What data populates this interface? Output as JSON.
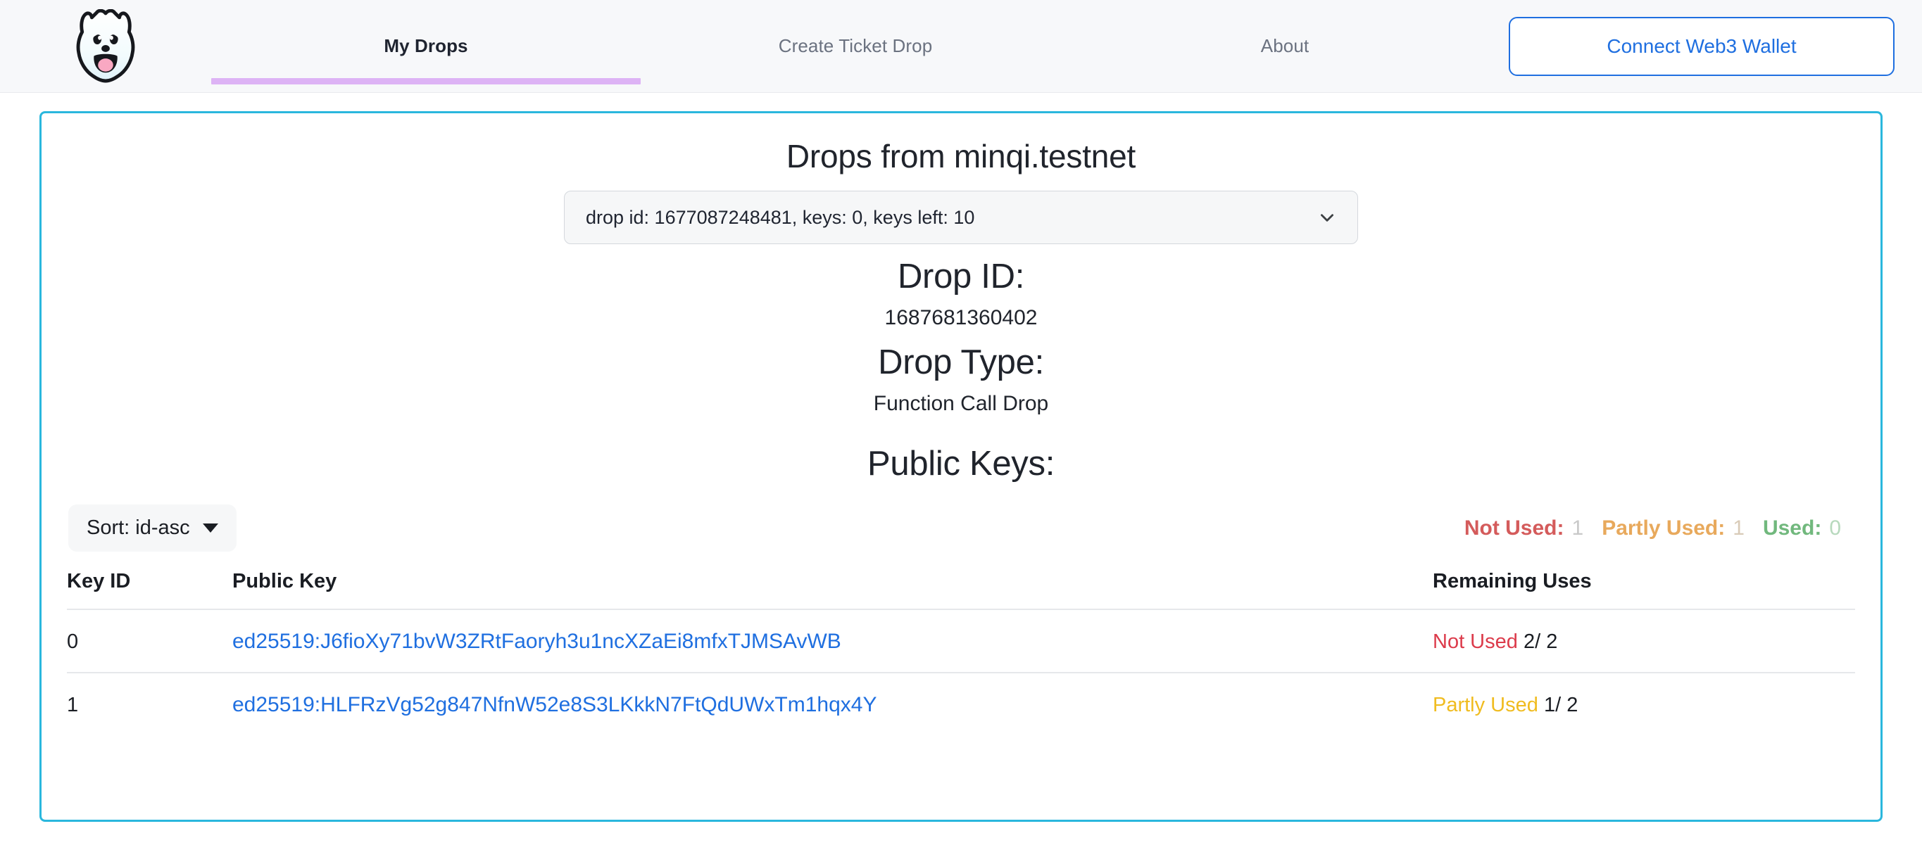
{
  "nav": {
    "logo_icon": "keypom-dog-logo-icon",
    "items": [
      {
        "label": "My Drops",
        "active": true
      },
      {
        "label": "Create Ticket Drop",
        "active": false
      },
      {
        "label": "About",
        "active": false
      }
    ],
    "connect_button": "Connect Web3 Wallet"
  },
  "card": {
    "title": "Drops from minqi.testnet",
    "drop_selector": {
      "selected": "drop id: 1677087248481, keys: 0, keys left: 10",
      "chevron_icon": "chevron-down-icon"
    },
    "drop_id_heading": "Drop ID:",
    "drop_id_value": "1687681360402",
    "drop_type_heading": "Drop Type:",
    "drop_type_value": "Function Call Drop",
    "public_keys_heading": "Public Keys:",
    "toolbar": {
      "sort_label": "Sort: id-asc",
      "sort_caret_icon": "caret-down-icon",
      "counters": [
        {
          "label": "Not Used:",
          "count": "1",
          "color": "#d45b5b"
        },
        {
          "label": "Partly Used:",
          "count": "1",
          "color": "#e8a95c"
        },
        {
          "label": "Used:",
          "count": "0",
          "color": "#71b87d"
        }
      ]
    },
    "table": {
      "headers": {
        "key_id": "Key ID",
        "public_key": "Public Key",
        "remaining_uses": "Remaining Uses"
      },
      "rows": [
        {
          "key_id": "0",
          "public_key": "ed25519:J6fioXy71bvW3ZRtFaoryh3u1ncXZaEi8mfxTJMSAvWB",
          "status": "Not Used",
          "uses": "2/ 2"
        },
        {
          "key_id": "1",
          "public_key": "ed25519:HLFRzVg52g847NfnW52e8S3LKkkN7FtQdUWxTm1hqx4Y",
          "status": "Partly Used",
          "uses": "1/ 2"
        }
      ]
    }
  },
  "colors": {
    "card_border": "#2ab7dd",
    "active_tab_underline": "#ddb3f5",
    "link_blue": "#1f6fe0",
    "status_not_used": "#dc3b4b",
    "status_partly_used": "#f0bc20",
    "status_used": "#2fa14a"
  }
}
